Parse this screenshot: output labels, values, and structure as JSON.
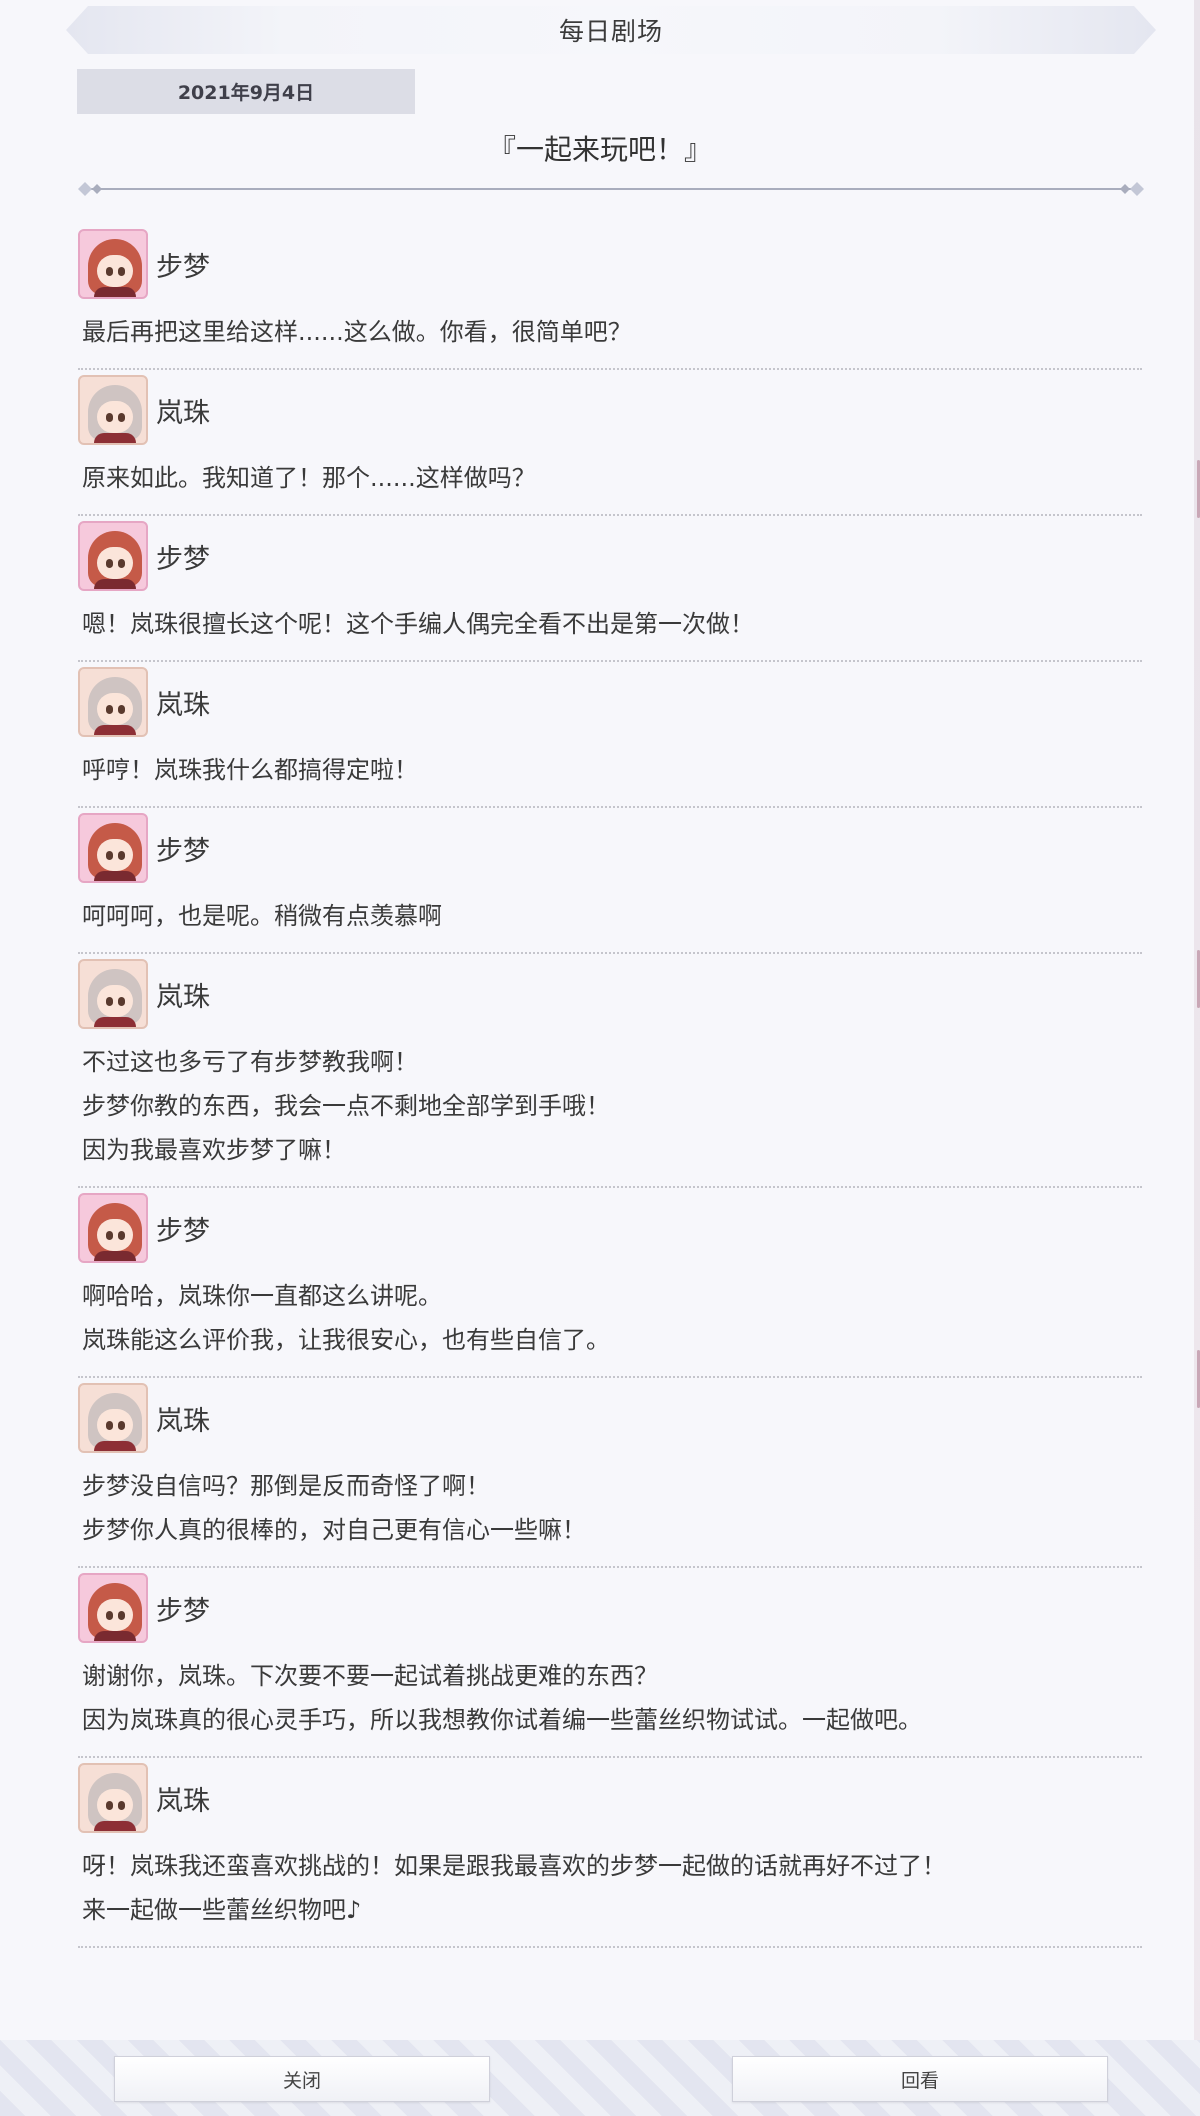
{
  "header": {
    "title": "每日剧场"
  },
  "date": "2021年9月4日",
  "episode_title": "『一起来玩吧！』",
  "dialogues": [
    {
      "speaker": "步梦",
      "avatar": "ayumu-avatar",
      "lines": [
        "最后再把这里给这样......这么做。你看，很简单吧？"
      ]
    },
    {
      "speaker": "岚珠",
      "avatar": "lanzhu-avatar",
      "lines": [
        "原来如此。我知道了！那个......这样做吗？"
      ]
    },
    {
      "speaker": "步梦",
      "avatar": "ayumu-avatar",
      "lines": [
        "嗯！岚珠很擅长这个呢！这个手编人偶完全看不出是第一次做！"
      ]
    },
    {
      "speaker": "岚珠",
      "avatar": "lanzhu-avatar",
      "lines": [
        "呼哼！岚珠我什么都搞得定啦！"
      ]
    },
    {
      "speaker": "步梦",
      "avatar": "ayumu-avatar",
      "lines": [
        "呵呵呵，也是呢。稍微有点羡慕啊"
      ]
    },
    {
      "speaker": "岚珠",
      "avatar": "lanzhu-avatar",
      "lines": [
        "不过这也多亏了有步梦教我啊！",
        "步梦你教的东西，我会一点不剩地全部学到手哦！",
        "因为我最喜欢步梦了嘛！"
      ]
    },
    {
      "speaker": "步梦",
      "avatar": "ayumu-avatar",
      "lines": [
        "啊哈哈，岚珠你一直都这么讲呢。",
        "岚珠能这么评价我，让我很安心，也有些自信了。"
      ]
    },
    {
      "speaker": "岚珠",
      "avatar": "lanzhu-avatar",
      "lines": [
        "步梦没自信吗？那倒是反而奇怪了啊！",
        "步梦你人真的很棒的，对自己更有信心一些嘛！"
      ]
    },
    {
      "speaker": "步梦",
      "avatar": "ayumu-avatar",
      "lines": [
        "谢谢你，岚珠。下次要不要一起试着挑战更难的东西？",
        "因为岚珠真的很心灵手巧，所以我想教你试着编一些蕾丝织物试试。一起做吧。"
      ]
    },
    {
      "speaker": "岚珠",
      "avatar": "lanzhu-avatar",
      "lines": [
        "呀！岚珠我还蛮喜欢挑战的！如果是跟我最喜欢的步梦一起做的话就再好不过了！",
        "来一起做一些蕾丝织物吧♪"
      ]
    }
  ],
  "footer": {
    "close_label": "关闭",
    "replay_label": "回看"
  },
  "colors": {
    "background": "#f7f7fb",
    "date_badge": "#dcdde6",
    "divider": "#c5c5cc"
  }
}
